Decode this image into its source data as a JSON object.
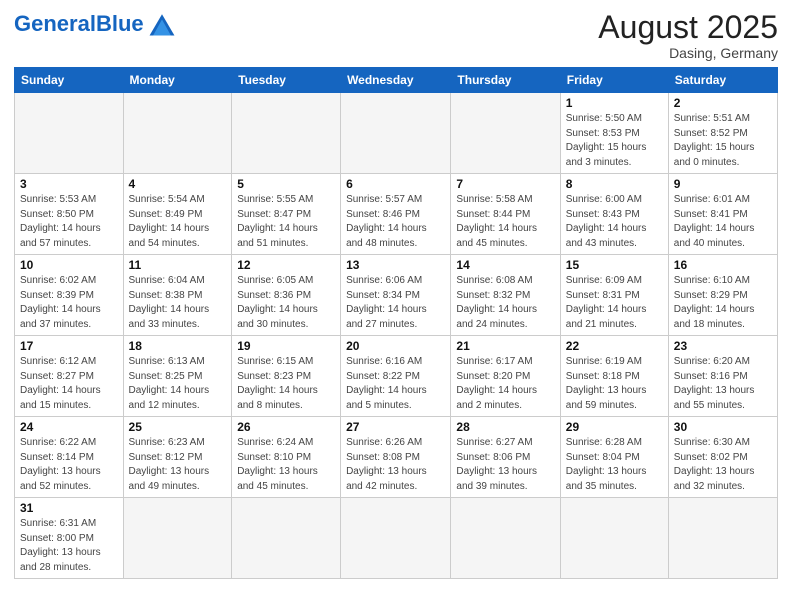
{
  "header": {
    "logo_general": "General",
    "logo_blue": "Blue",
    "title": "August 2025",
    "subtitle": "Dasing, Germany"
  },
  "weekdays": [
    "Sunday",
    "Monday",
    "Tuesday",
    "Wednesday",
    "Thursday",
    "Friday",
    "Saturday"
  ],
  "weeks": [
    [
      {
        "num": "",
        "info": "",
        "empty": true
      },
      {
        "num": "",
        "info": "",
        "empty": true
      },
      {
        "num": "",
        "info": "",
        "empty": true
      },
      {
        "num": "",
        "info": "",
        "empty": true
      },
      {
        "num": "",
        "info": "",
        "empty": true
      },
      {
        "num": "1",
        "info": "Sunrise: 5:50 AM\nSunset: 8:53 PM\nDaylight: 15 hours\nand 3 minutes.",
        "empty": false
      },
      {
        "num": "2",
        "info": "Sunrise: 5:51 AM\nSunset: 8:52 PM\nDaylight: 15 hours\nand 0 minutes.",
        "empty": false
      }
    ],
    [
      {
        "num": "3",
        "info": "Sunrise: 5:53 AM\nSunset: 8:50 PM\nDaylight: 14 hours\nand 57 minutes.",
        "empty": false
      },
      {
        "num": "4",
        "info": "Sunrise: 5:54 AM\nSunset: 8:49 PM\nDaylight: 14 hours\nand 54 minutes.",
        "empty": false
      },
      {
        "num": "5",
        "info": "Sunrise: 5:55 AM\nSunset: 8:47 PM\nDaylight: 14 hours\nand 51 minutes.",
        "empty": false
      },
      {
        "num": "6",
        "info": "Sunrise: 5:57 AM\nSunset: 8:46 PM\nDaylight: 14 hours\nand 48 minutes.",
        "empty": false
      },
      {
        "num": "7",
        "info": "Sunrise: 5:58 AM\nSunset: 8:44 PM\nDaylight: 14 hours\nand 45 minutes.",
        "empty": false
      },
      {
        "num": "8",
        "info": "Sunrise: 6:00 AM\nSunset: 8:43 PM\nDaylight: 14 hours\nand 43 minutes.",
        "empty": false
      },
      {
        "num": "9",
        "info": "Sunrise: 6:01 AM\nSunset: 8:41 PM\nDaylight: 14 hours\nand 40 minutes.",
        "empty": false
      }
    ],
    [
      {
        "num": "10",
        "info": "Sunrise: 6:02 AM\nSunset: 8:39 PM\nDaylight: 14 hours\nand 37 minutes.",
        "empty": false
      },
      {
        "num": "11",
        "info": "Sunrise: 6:04 AM\nSunset: 8:38 PM\nDaylight: 14 hours\nand 33 minutes.",
        "empty": false
      },
      {
        "num": "12",
        "info": "Sunrise: 6:05 AM\nSunset: 8:36 PM\nDaylight: 14 hours\nand 30 minutes.",
        "empty": false
      },
      {
        "num": "13",
        "info": "Sunrise: 6:06 AM\nSunset: 8:34 PM\nDaylight: 14 hours\nand 27 minutes.",
        "empty": false
      },
      {
        "num": "14",
        "info": "Sunrise: 6:08 AM\nSunset: 8:32 PM\nDaylight: 14 hours\nand 24 minutes.",
        "empty": false
      },
      {
        "num": "15",
        "info": "Sunrise: 6:09 AM\nSunset: 8:31 PM\nDaylight: 14 hours\nand 21 minutes.",
        "empty": false
      },
      {
        "num": "16",
        "info": "Sunrise: 6:10 AM\nSunset: 8:29 PM\nDaylight: 14 hours\nand 18 minutes.",
        "empty": false
      }
    ],
    [
      {
        "num": "17",
        "info": "Sunrise: 6:12 AM\nSunset: 8:27 PM\nDaylight: 14 hours\nand 15 minutes.",
        "empty": false
      },
      {
        "num": "18",
        "info": "Sunrise: 6:13 AM\nSunset: 8:25 PM\nDaylight: 14 hours\nand 12 minutes.",
        "empty": false
      },
      {
        "num": "19",
        "info": "Sunrise: 6:15 AM\nSunset: 8:23 PM\nDaylight: 14 hours\nand 8 minutes.",
        "empty": false
      },
      {
        "num": "20",
        "info": "Sunrise: 6:16 AM\nSunset: 8:22 PM\nDaylight: 14 hours\nand 5 minutes.",
        "empty": false
      },
      {
        "num": "21",
        "info": "Sunrise: 6:17 AM\nSunset: 8:20 PM\nDaylight: 14 hours\nand 2 minutes.",
        "empty": false
      },
      {
        "num": "22",
        "info": "Sunrise: 6:19 AM\nSunset: 8:18 PM\nDaylight: 13 hours\nand 59 minutes.",
        "empty": false
      },
      {
        "num": "23",
        "info": "Sunrise: 6:20 AM\nSunset: 8:16 PM\nDaylight: 13 hours\nand 55 minutes.",
        "empty": false
      }
    ],
    [
      {
        "num": "24",
        "info": "Sunrise: 6:22 AM\nSunset: 8:14 PM\nDaylight: 13 hours\nand 52 minutes.",
        "empty": false
      },
      {
        "num": "25",
        "info": "Sunrise: 6:23 AM\nSunset: 8:12 PM\nDaylight: 13 hours\nand 49 minutes.",
        "empty": false
      },
      {
        "num": "26",
        "info": "Sunrise: 6:24 AM\nSunset: 8:10 PM\nDaylight: 13 hours\nand 45 minutes.",
        "empty": false
      },
      {
        "num": "27",
        "info": "Sunrise: 6:26 AM\nSunset: 8:08 PM\nDaylight: 13 hours\nand 42 minutes.",
        "empty": false
      },
      {
        "num": "28",
        "info": "Sunrise: 6:27 AM\nSunset: 8:06 PM\nDaylight: 13 hours\nand 39 minutes.",
        "empty": false
      },
      {
        "num": "29",
        "info": "Sunrise: 6:28 AM\nSunset: 8:04 PM\nDaylight: 13 hours\nand 35 minutes.",
        "empty": false
      },
      {
        "num": "30",
        "info": "Sunrise: 6:30 AM\nSunset: 8:02 PM\nDaylight: 13 hours\nand 32 minutes.",
        "empty": false
      }
    ],
    [
      {
        "num": "31",
        "info": "Sunrise: 6:31 AM\nSunset: 8:00 PM\nDaylight: 13 hours\nand 28 minutes.",
        "empty": false
      },
      {
        "num": "",
        "info": "",
        "empty": true
      },
      {
        "num": "",
        "info": "",
        "empty": true
      },
      {
        "num": "",
        "info": "",
        "empty": true
      },
      {
        "num": "",
        "info": "",
        "empty": true
      },
      {
        "num": "",
        "info": "",
        "empty": true
      },
      {
        "num": "",
        "info": "",
        "empty": true
      }
    ]
  ]
}
